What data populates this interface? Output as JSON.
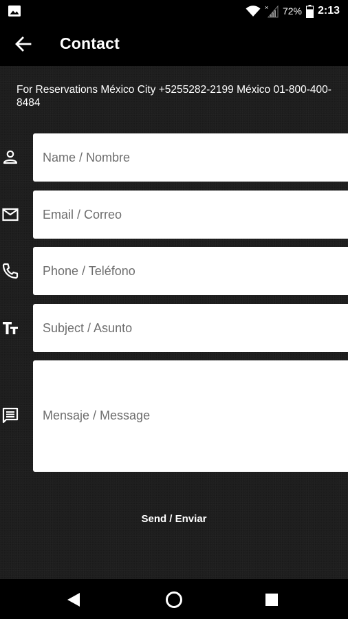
{
  "status_bar": {
    "battery_percent": "72%",
    "time": "2:13",
    "icons": [
      "gallery-icon",
      "wifi-icon",
      "signal-icon",
      "battery-icon"
    ]
  },
  "app_bar": {
    "title": "Contact",
    "back_icon": "arrow-back-icon"
  },
  "reservations_text": "For Reservations México City +5255282-2199 México 01-800-400-8484",
  "form": {
    "name": {
      "placeholder": "Name / Nombre",
      "value": "",
      "icon": "person-icon"
    },
    "email": {
      "placeholder": "Email / Correo",
      "value": "",
      "icon": "mail-icon"
    },
    "phone": {
      "placeholder": "Phone / Teléfono",
      "value": "",
      "icon": "phone-icon"
    },
    "subject": {
      "placeholder": "Subject / Asunto",
      "value": "",
      "icon": "text-fields-icon"
    },
    "message": {
      "placeholder": "Mensaje / Message",
      "value": "",
      "icon": "chat-icon"
    }
  },
  "send_label": "Send / Enviar",
  "nav_bar": {
    "icons": [
      "back-triangle-icon",
      "home-circle-icon",
      "recents-square-icon"
    ]
  },
  "colors": {
    "background": "#1e1e1e",
    "bars": "#000000",
    "field": "#ffffff",
    "placeholder": "#6e6e6e",
    "text": "#ffffff"
  }
}
